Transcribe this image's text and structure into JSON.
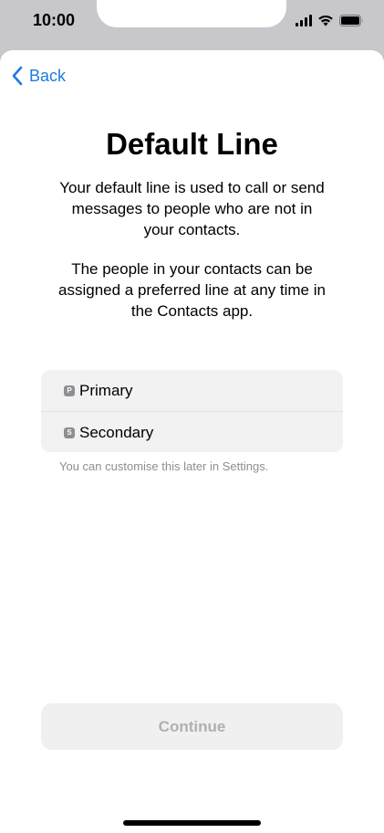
{
  "status_bar": {
    "time": "10:00"
  },
  "nav": {
    "back_label": "Back"
  },
  "page": {
    "title": "Default Line",
    "paragraph1": "Your default line is used to call or send messages to people who are not in your contacts.",
    "paragraph2": "The people in your contacts can be assigned a preferred line at any time in the Contacts app."
  },
  "options": [
    {
      "badge": "P",
      "label": "Primary"
    },
    {
      "badge": "S",
      "label": "Secondary"
    }
  ],
  "hint": "You can customise this later in Settings.",
  "continue_label": "Continue",
  "colors": {
    "accent": "#1f7ae0",
    "disabled_text": "#b0b0b3"
  }
}
